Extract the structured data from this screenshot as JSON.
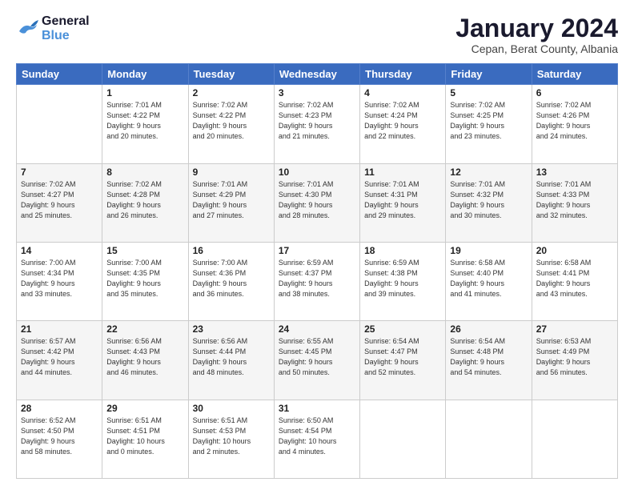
{
  "logo": {
    "line1": "General",
    "line2": "Blue"
  },
  "title": "January 2024",
  "subtitle": "Cepan, Berat County, Albania",
  "days_header": [
    "Sunday",
    "Monday",
    "Tuesday",
    "Wednesday",
    "Thursday",
    "Friday",
    "Saturday"
  ],
  "weeks": [
    [
      {
        "day": "",
        "info": ""
      },
      {
        "day": "1",
        "info": "Sunrise: 7:01 AM\nSunset: 4:22 PM\nDaylight: 9 hours\nand 20 minutes."
      },
      {
        "day": "2",
        "info": "Sunrise: 7:02 AM\nSunset: 4:22 PM\nDaylight: 9 hours\nand 20 minutes."
      },
      {
        "day": "3",
        "info": "Sunrise: 7:02 AM\nSunset: 4:23 PM\nDaylight: 9 hours\nand 21 minutes."
      },
      {
        "day": "4",
        "info": "Sunrise: 7:02 AM\nSunset: 4:24 PM\nDaylight: 9 hours\nand 22 minutes."
      },
      {
        "day": "5",
        "info": "Sunrise: 7:02 AM\nSunset: 4:25 PM\nDaylight: 9 hours\nand 23 minutes."
      },
      {
        "day": "6",
        "info": "Sunrise: 7:02 AM\nSunset: 4:26 PM\nDaylight: 9 hours\nand 24 minutes."
      }
    ],
    [
      {
        "day": "7",
        "info": "Sunrise: 7:02 AM\nSunset: 4:27 PM\nDaylight: 9 hours\nand 25 minutes."
      },
      {
        "day": "8",
        "info": "Sunrise: 7:02 AM\nSunset: 4:28 PM\nDaylight: 9 hours\nand 26 minutes."
      },
      {
        "day": "9",
        "info": "Sunrise: 7:01 AM\nSunset: 4:29 PM\nDaylight: 9 hours\nand 27 minutes."
      },
      {
        "day": "10",
        "info": "Sunrise: 7:01 AM\nSunset: 4:30 PM\nDaylight: 9 hours\nand 28 minutes."
      },
      {
        "day": "11",
        "info": "Sunrise: 7:01 AM\nSunset: 4:31 PM\nDaylight: 9 hours\nand 29 minutes."
      },
      {
        "day": "12",
        "info": "Sunrise: 7:01 AM\nSunset: 4:32 PM\nDaylight: 9 hours\nand 30 minutes."
      },
      {
        "day": "13",
        "info": "Sunrise: 7:01 AM\nSunset: 4:33 PM\nDaylight: 9 hours\nand 32 minutes."
      }
    ],
    [
      {
        "day": "14",
        "info": "Sunrise: 7:00 AM\nSunset: 4:34 PM\nDaylight: 9 hours\nand 33 minutes."
      },
      {
        "day": "15",
        "info": "Sunrise: 7:00 AM\nSunset: 4:35 PM\nDaylight: 9 hours\nand 35 minutes."
      },
      {
        "day": "16",
        "info": "Sunrise: 7:00 AM\nSunset: 4:36 PM\nDaylight: 9 hours\nand 36 minutes."
      },
      {
        "day": "17",
        "info": "Sunrise: 6:59 AM\nSunset: 4:37 PM\nDaylight: 9 hours\nand 38 minutes."
      },
      {
        "day": "18",
        "info": "Sunrise: 6:59 AM\nSunset: 4:38 PM\nDaylight: 9 hours\nand 39 minutes."
      },
      {
        "day": "19",
        "info": "Sunrise: 6:58 AM\nSunset: 4:40 PM\nDaylight: 9 hours\nand 41 minutes."
      },
      {
        "day": "20",
        "info": "Sunrise: 6:58 AM\nSunset: 4:41 PM\nDaylight: 9 hours\nand 43 minutes."
      }
    ],
    [
      {
        "day": "21",
        "info": "Sunrise: 6:57 AM\nSunset: 4:42 PM\nDaylight: 9 hours\nand 44 minutes."
      },
      {
        "day": "22",
        "info": "Sunrise: 6:56 AM\nSunset: 4:43 PM\nDaylight: 9 hours\nand 46 minutes."
      },
      {
        "day": "23",
        "info": "Sunrise: 6:56 AM\nSunset: 4:44 PM\nDaylight: 9 hours\nand 48 minutes."
      },
      {
        "day": "24",
        "info": "Sunrise: 6:55 AM\nSunset: 4:45 PM\nDaylight: 9 hours\nand 50 minutes."
      },
      {
        "day": "25",
        "info": "Sunrise: 6:54 AM\nSunset: 4:47 PM\nDaylight: 9 hours\nand 52 minutes."
      },
      {
        "day": "26",
        "info": "Sunrise: 6:54 AM\nSunset: 4:48 PM\nDaylight: 9 hours\nand 54 minutes."
      },
      {
        "day": "27",
        "info": "Sunrise: 6:53 AM\nSunset: 4:49 PM\nDaylight: 9 hours\nand 56 minutes."
      }
    ],
    [
      {
        "day": "28",
        "info": "Sunrise: 6:52 AM\nSunset: 4:50 PM\nDaylight: 9 hours\nand 58 minutes."
      },
      {
        "day": "29",
        "info": "Sunrise: 6:51 AM\nSunset: 4:51 PM\nDaylight: 10 hours\nand 0 minutes."
      },
      {
        "day": "30",
        "info": "Sunrise: 6:51 AM\nSunset: 4:53 PM\nDaylight: 10 hours\nand 2 minutes."
      },
      {
        "day": "31",
        "info": "Sunrise: 6:50 AM\nSunset: 4:54 PM\nDaylight: 10 hours\nand 4 minutes."
      },
      {
        "day": "",
        "info": ""
      },
      {
        "day": "",
        "info": ""
      },
      {
        "day": "",
        "info": ""
      }
    ]
  ]
}
